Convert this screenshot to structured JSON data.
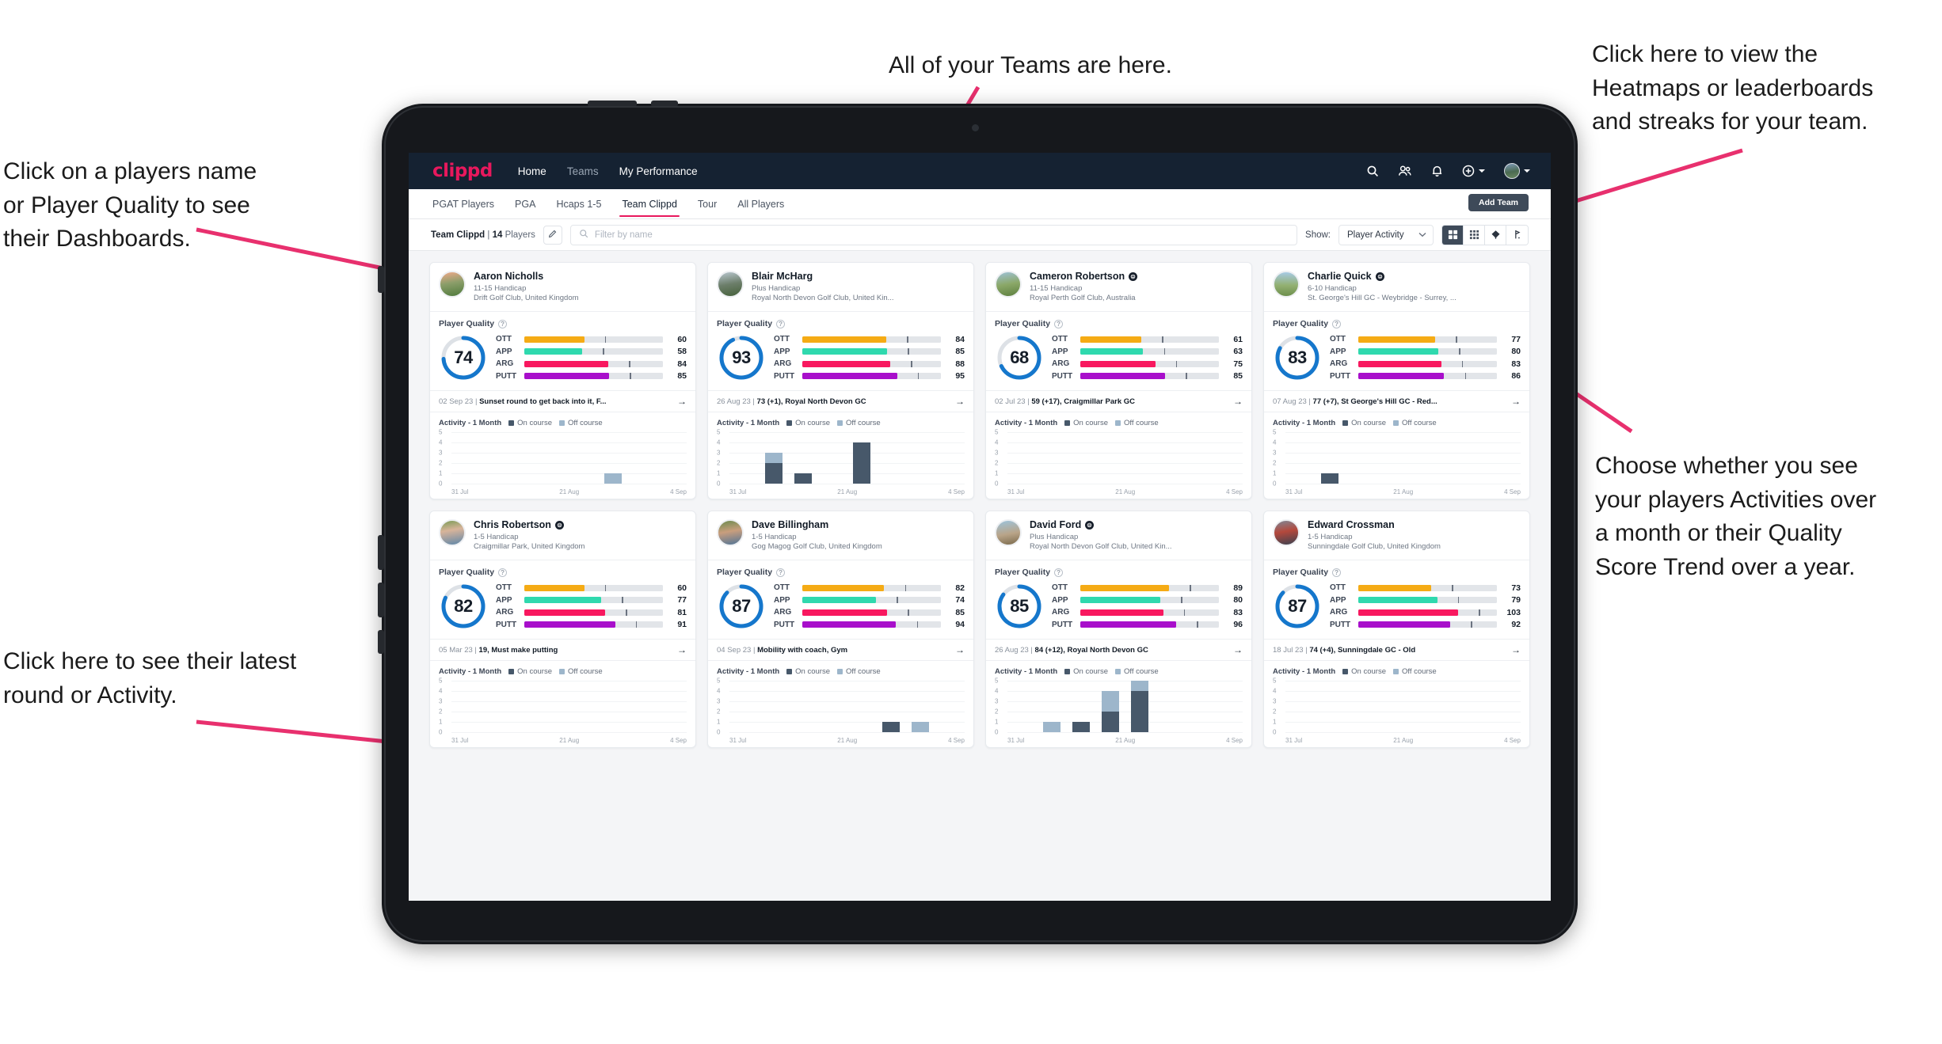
{
  "annotations": [
    {
      "id": "teams",
      "text": "All of your Teams are here."
    },
    {
      "id": "heatmaps",
      "text": "Click here to view the\nHeatmaps or leaderboards\nand streaks for your team."
    },
    {
      "id": "players-name",
      "text": "Click on a players name\nor Player Quality to see\ntheir Dashboards."
    },
    {
      "id": "activity-toggle",
      "text": "Choose whether you see\nyour players Activities over\na month or their Quality\nScore Trend over a year."
    },
    {
      "id": "latest-round",
      "text": "Click here to see their latest\nround or Activity."
    }
  ],
  "app": {
    "brand": "clippd",
    "nav": [
      {
        "label": "Home",
        "active": true
      },
      {
        "label": "Teams",
        "active": false
      },
      {
        "label": "My Performance",
        "active": false
      }
    ],
    "nav_icons": [
      "search-icon",
      "people-icon",
      "bell-icon",
      "plus-circle-icon",
      "avatar"
    ],
    "tabs": [
      {
        "label": "PGAT Players",
        "active": false
      },
      {
        "label": "PGA",
        "active": false
      },
      {
        "label": "Hcaps 1-5",
        "active": false
      },
      {
        "label": "Team Clippd",
        "active": true
      },
      {
        "label": "Tour",
        "active": false
      },
      {
        "label": "All Players",
        "active": false
      }
    ],
    "add_team_label": "Add Team",
    "filter": {
      "team_name": "Team Clippd",
      "separator": "|",
      "player_count": "14",
      "players_word": "Players",
      "edit_icon": "pencil-icon",
      "search_placeholder": "Filter by name",
      "show_label": "Show:",
      "show_value": "Player Activity",
      "views": [
        {
          "name": "grid-large-view",
          "active": true
        },
        {
          "name": "grid-small-view",
          "active": false
        },
        {
          "name": "heatmap-view",
          "active": false
        },
        {
          "name": "leaderboard-view",
          "active": false
        }
      ]
    }
  },
  "labels": {
    "player_quality": "Player Quality",
    "activity_title": "Activity - 1 Month",
    "legend_on": "On course",
    "legend_off": "Off course",
    "metric_names": [
      "OTT",
      "APP",
      "ARG",
      "PUTT"
    ],
    "x_ticks": [
      "31 Jul",
      "21 Aug",
      "4 Sep"
    ],
    "y_ticks": [
      "5",
      "4",
      "3",
      "2",
      "1",
      "0"
    ]
  },
  "colors": {
    "brand": "#e8185d",
    "navbar": "#152232",
    "ott": "#f5ab15",
    "app": "#2fd9ae",
    "arg": "#f8185f",
    "putt": "#a80fcb",
    "ring": "#1577cc",
    "on_course": "#47586a",
    "off_course": "#9db6cb"
  },
  "players": [
    {
      "name": "Aaron Nicholls",
      "verified": false,
      "handicap": "11-15 Handicap",
      "club": "Drift Golf Club, United Kingdom",
      "quality": 74,
      "metrics": [
        60,
        58,
        84,
        85
      ],
      "round": {
        "date": "02 Sep 23",
        "text": "Sunset round to get back into it, F..."
      },
      "chart_data": {
        "type": "bar",
        "title": "Activity - 1 Month",
        "categories": [
          "31 Jul",
          "",
          "",
          "",
          "21 Aug",
          "",
          "4 Sep",
          ""
        ],
        "series": [
          {
            "name": "On course",
            "values": [
              0,
              0,
              0,
              0,
              0,
              0,
              0,
              0
            ]
          },
          {
            "name": "Off course",
            "values": [
              0,
              0,
              0,
              0,
              0,
              1,
              0,
              0
            ]
          }
        ],
        "ylim": [
          0,
          5
        ],
        "ylabel": "",
        "xlabel": ""
      }
    },
    {
      "name": "Blair McHarg",
      "verified": false,
      "handicap": "Plus Handicap",
      "club": "Royal North Devon Golf Club, United Kin...",
      "quality": 93,
      "metrics": [
        84,
        85,
        88,
        95
      ],
      "round": {
        "date": "26 Aug 23",
        "text": "73 (+1), Royal North Devon GC"
      },
      "chart_data": {
        "type": "bar",
        "title": "Activity - 1 Month",
        "categories": [
          "31 Jul",
          "",
          "",
          "",
          "21 Aug",
          "",
          "4 Sep",
          ""
        ],
        "series": [
          {
            "name": "On course",
            "values": [
              0,
              2,
              1,
              0,
              4,
              0,
              0,
              0
            ]
          },
          {
            "name": "Off course",
            "values": [
              0,
              1,
              0,
              0,
              0,
              0,
              0,
              0
            ]
          }
        ],
        "ylim": [
          0,
          5
        ],
        "ylabel": "",
        "xlabel": ""
      }
    },
    {
      "name": "Cameron Robertson",
      "verified": true,
      "handicap": "11-15 Handicap",
      "club": "Royal Perth Golf Club, Australia",
      "quality": 68,
      "metrics": [
        61,
        63,
        75,
        85
      ],
      "round": {
        "date": "02 Jul 23",
        "text": "59 (+17), Craigmillar Park GC"
      },
      "chart_data": {
        "type": "bar",
        "title": "Activity - 1 Month",
        "categories": [
          "31 Jul",
          "",
          "",
          "",
          "21 Aug",
          "",
          "4 Sep",
          ""
        ],
        "series": [
          {
            "name": "On course",
            "values": [
              0,
              0,
              0,
              0,
              0,
              0,
              0,
              0
            ]
          },
          {
            "name": "Off course",
            "values": [
              0,
              0,
              0,
              0,
              0,
              0,
              0,
              0
            ]
          }
        ],
        "ylim": [
          0,
          5
        ],
        "ylabel": "",
        "xlabel": ""
      }
    },
    {
      "name": "Charlie Quick",
      "verified": true,
      "handicap": "6-10 Handicap",
      "club": "St. George's Hill GC - Weybridge - Surrey, ...",
      "quality": 83,
      "metrics": [
        77,
        80,
        83,
        86
      ],
      "round": {
        "date": "07 Aug 23",
        "text": "77 (+7), St George's Hill GC - Red..."
      },
      "chart_data": {
        "type": "bar",
        "title": "Activity - 1 Month",
        "categories": [
          "31 Jul",
          "",
          "",
          "",
          "21 Aug",
          "",
          "4 Sep",
          ""
        ],
        "series": [
          {
            "name": "On course",
            "values": [
              0,
              1,
              0,
              0,
              0,
              0,
              0,
              0
            ]
          },
          {
            "name": "Off course",
            "values": [
              0,
              0,
              0,
              0,
              0,
              0,
              0,
              0
            ]
          }
        ],
        "ylim": [
          0,
          5
        ],
        "ylabel": "",
        "xlabel": ""
      }
    },
    {
      "name": "Chris Robertson",
      "verified": true,
      "handicap": "1-5 Handicap",
      "club": "Craigmillar Park, United Kingdom",
      "quality": 82,
      "metrics": [
        60,
        77,
        81,
        91
      ],
      "round": {
        "date": "05 Mar 23",
        "text": "19, Must make putting"
      },
      "chart_data": {
        "type": "bar",
        "title": "Activity - 1 Month",
        "categories": [
          "31 Jul",
          "",
          "",
          "",
          "21 Aug",
          "",
          "4 Sep",
          ""
        ],
        "series": [
          {
            "name": "On course",
            "values": [
              0,
              0,
              0,
              0,
              0,
              0,
              0,
              0
            ]
          },
          {
            "name": "Off course",
            "values": [
              0,
              0,
              0,
              0,
              0,
              0,
              0,
              0
            ]
          }
        ],
        "ylim": [
          0,
          5
        ],
        "ylabel": "",
        "xlabel": ""
      }
    },
    {
      "name": "Dave Billingham",
      "verified": false,
      "handicap": "1-5 Handicap",
      "club": "Gog Magog Golf Club, United Kingdom",
      "quality": 87,
      "metrics": [
        82,
        74,
        85,
        94
      ],
      "round": {
        "date": "04 Sep 23",
        "text": "Mobility with coach, Gym"
      },
      "chart_data": {
        "type": "bar",
        "title": "Activity - 1 Month",
        "categories": [
          "31 Jul",
          "",
          "",
          "",
          "21 Aug",
          "",
          "4 Sep",
          ""
        ],
        "series": [
          {
            "name": "On course",
            "values": [
              0,
              0,
              0,
              0,
              0,
              1,
              0,
              0
            ]
          },
          {
            "name": "Off course",
            "values": [
              0,
              0,
              0,
              0,
              0,
              0,
              1,
              0
            ]
          }
        ],
        "ylim": [
          0,
          5
        ],
        "ylabel": "",
        "xlabel": ""
      }
    },
    {
      "name": "David Ford",
      "verified": true,
      "handicap": "Plus Handicap",
      "club": "Royal North Devon Golf Club, United Kin...",
      "quality": 85,
      "metrics": [
        89,
        80,
        83,
        96
      ],
      "round": {
        "date": "26 Aug 23",
        "text": "84 (+12), Royal North Devon GC"
      },
      "chart_data": {
        "type": "bar",
        "title": "Activity - 1 Month",
        "categories": [
          "31 Jul",
          "",
          "",
          "",
          "21 Aug",
          "",
          "4 Sep",
          ""
        ],
        "series": [
          {
            "name": "On course",
            "values": [
              0,
              0,
              1,
              2,
              4,
              0,
              0,
              0
            ]
          },
          {
            "name": "Off course",
            "values": [
              0,
              1,
              0,
              2,
              1,
              0,
              0,
              0
            ]
          }
        ],
        "ylim": [
          0,
          5
        ],
        "ylabel": "",
        "xlabel": ""
      }
    },
    {
      "name": "Edward Crossman",
      "verified": false,
      "handicap": "1-5 Handicap",
      "club": "Sunningdale Golf Club, United Kingdom",
      "quality": 87,
      "metrics": [
        73,
        79,
        103,
        92
      ],
      "round": {
        "date": "18 Jul 23",
        "text": "74 (+4), Sunningdale GC - Old"
      },
      "chart_data": {
        "type": "bar",
        "title": "Activity - 1 Month",
        "categories": [
          "31 Jul",
          "",
          "",
          "",
          "21 Aug",
          "",
          "4 Sep",
          ""
        ],
        "series": [
          {
            "name": "On course",
            "values": [
              0,
              0,
              0,
              0,
              0,
              0,
              0,
              0
            ]
          },
          {
            "name": "Off course",
            "values": [
              0,
              0,
              0,
              0,
              0,
              0,
              0,
              0
            ]
          }
        ],
        "ylim": [
          0,
          5
        ],
        "ylabel": "",
        "xlabel": ""
      }
    }
  ]
}
